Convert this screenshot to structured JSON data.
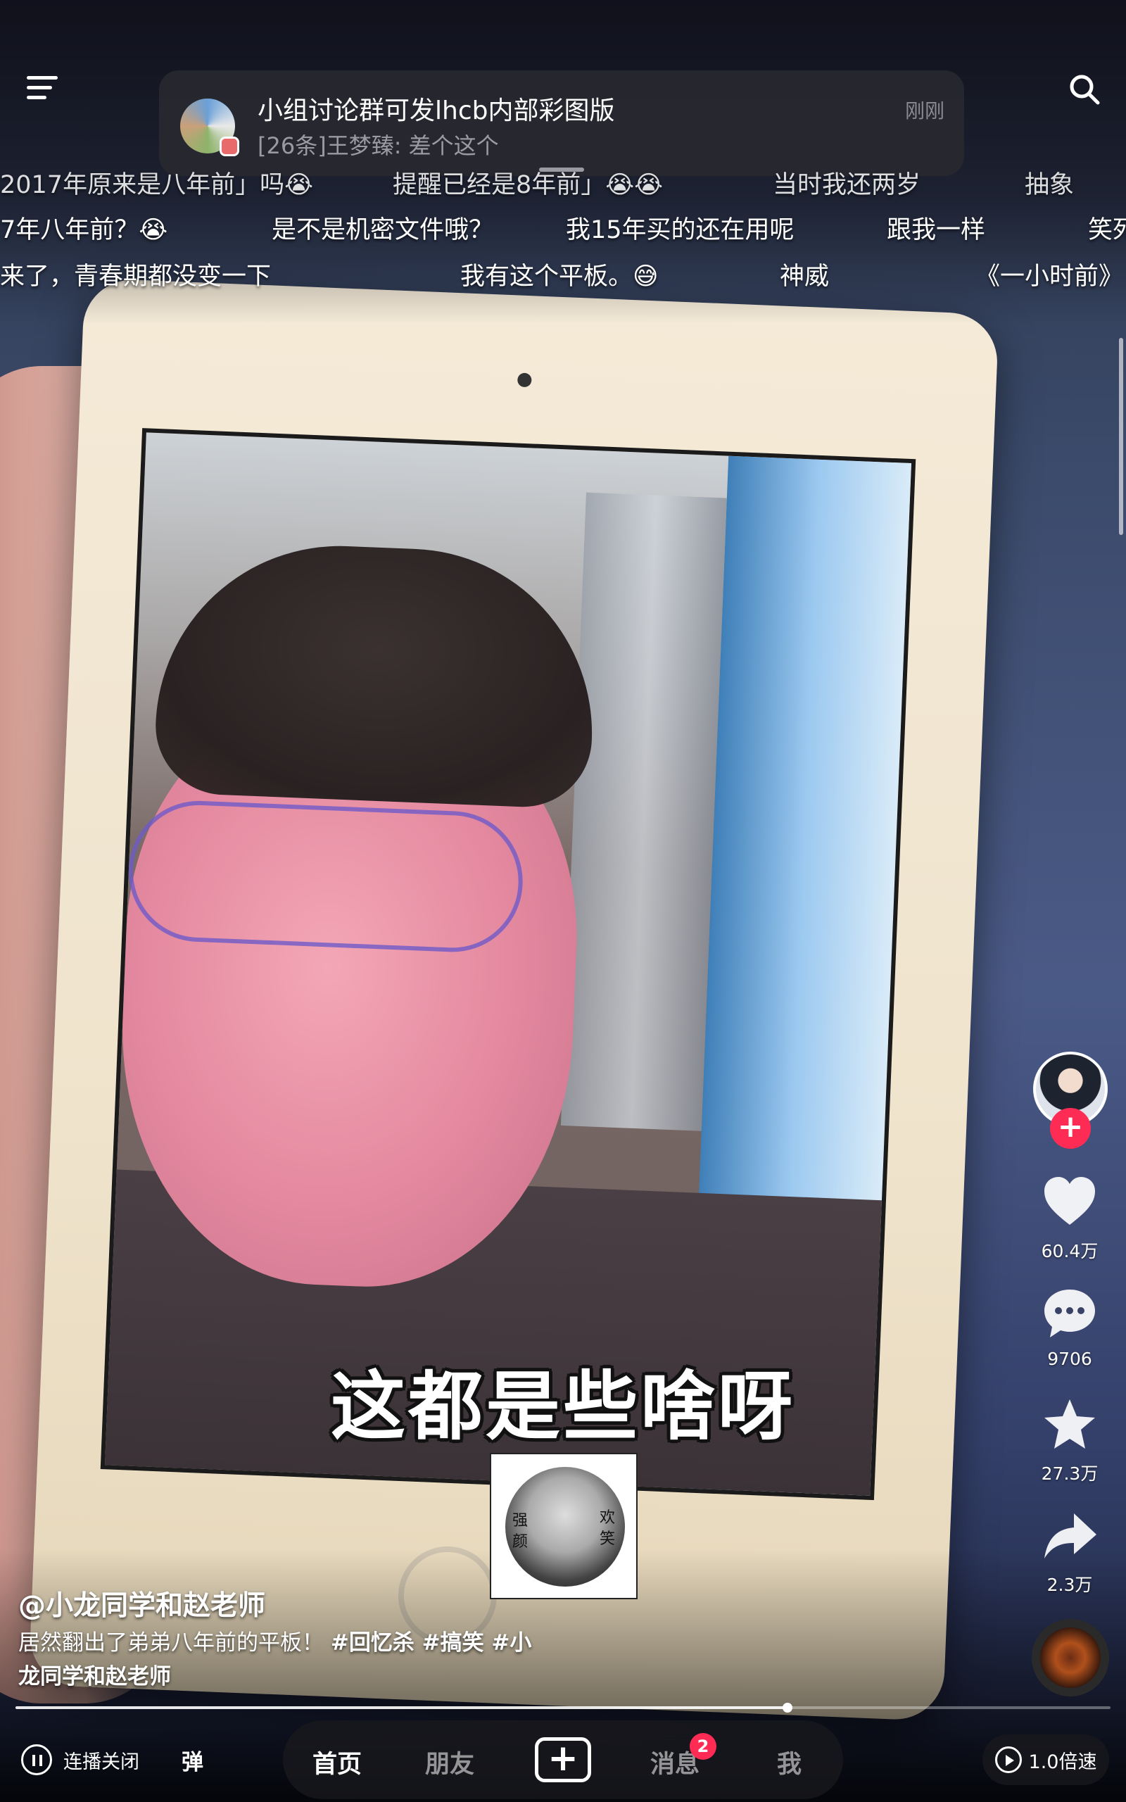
{
  "notification": {
    "title": "小组讨论群可发lhcb内部彩图版",
    "body": "[26条]王梦臻: 差个这个",
    "time": "刚刚"
  },
  "danmaku": {
    "row1": [
      "2017年原来是八年前」吗😭",
      "提醒已经是8年前」😭😭",
      "当时我还两岁",
      "抽象"
    ],
    "row2": [
      "7年八年前？😭",
      "是不是机密文件哦？",
      "我15年买的还在用呢",
      "跟我一样",
      "笑死"
    ],
    "row3": [
      "来了，青春期都没变一下",
      "我有这个平板。😅",
      "神威",
      "《一小时前》"
    ]
  },
  "actions": {
    "likes": "60.4万",
    "comments": "9706",
    "favorites": "27.3万",
    "shares": "2.3万"
  },
  "video": {
    "subtitle": "这都是些啥呀",
    "sticker_left": "强\n颜",
    "sticker_right": "欢\n笑",
    "author": "@小龙同学和赵老师",
    "description": "居然翻出了弟弟八年前的平板！",
    "tags": "#回忆杀 #搞笑 #小龙同学和赵老师",
    "progress": 0.705
  },
  "controls": {
    "autoplay_label": "连播关闭",
    "danmaku_label": "弹",
    "speed_label": "1.0倍速"
  },
  "tabs": {
    "home": "首页",
    "friends": "朋友",
    "messages": "消息",
    "messages_badge": "2",
    "me": "我"
  },
  "colors": {
    "accent": "#fe2c55",
    "banner_bg": "#28282f"
  },
  "icons": {
    "menu": "menu-icon",
    "search": "search-icon",
    "like": "heart-icon",
    "comment": "comment-icon",
    "favorite": "star-icon",
    "share": "share-icon",
    "create": "plus-icon"
  }
}
